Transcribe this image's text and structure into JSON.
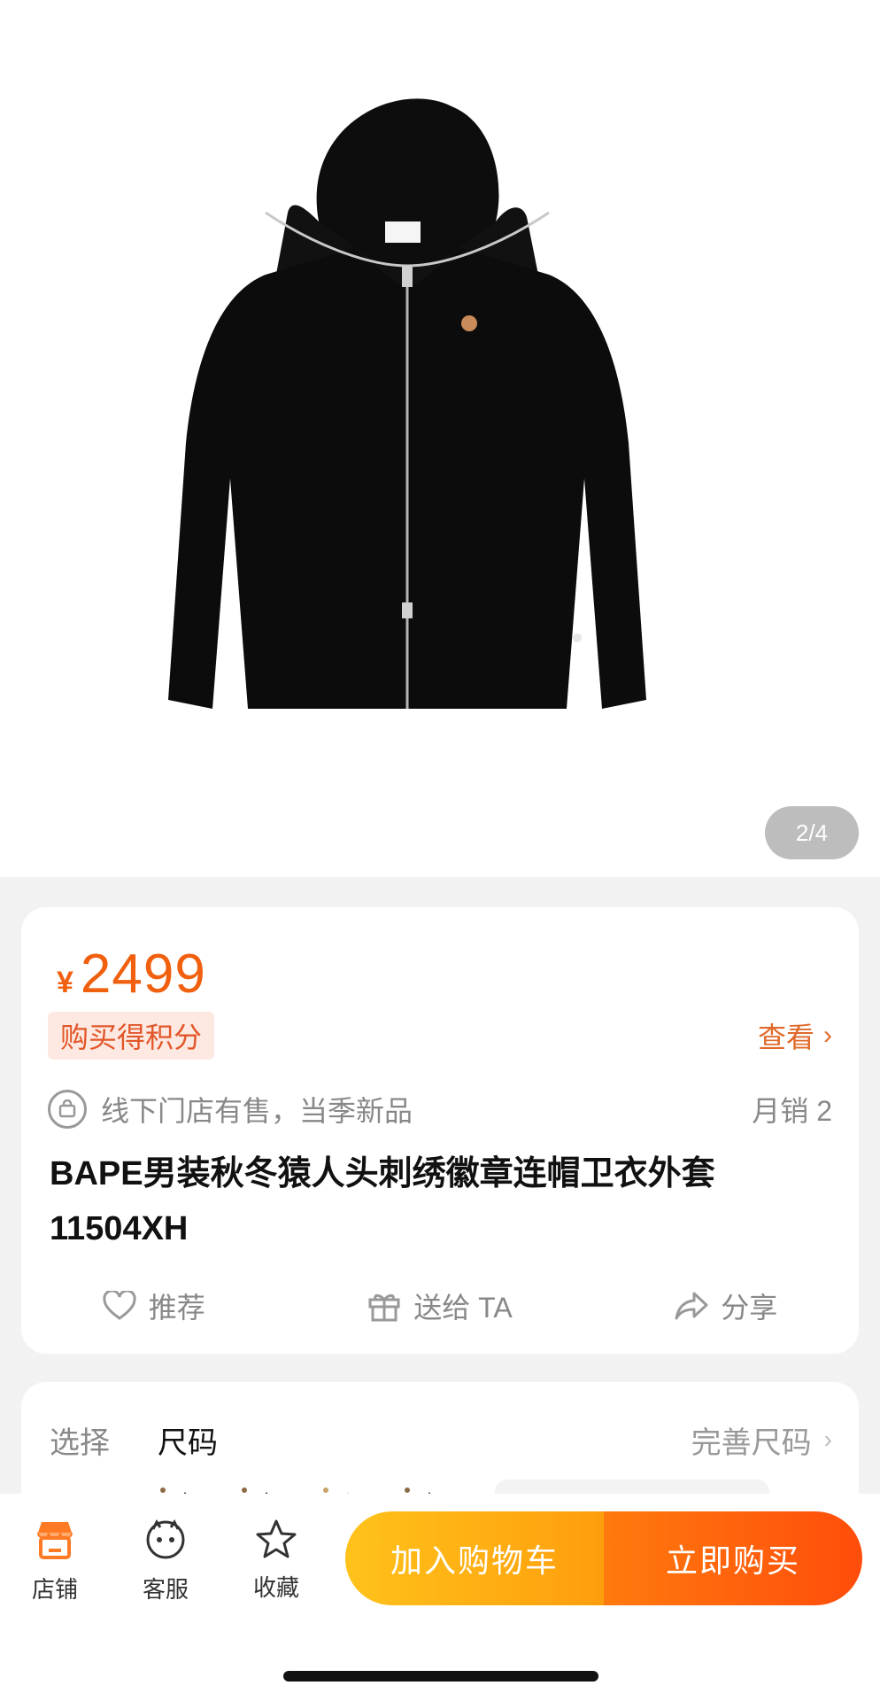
{
  "gallery": {
    "pager": "2/4"
  },
  "product": {
    "currency": "¥",
    "price": "2499",
    "points_badge": "购买得积分",
    "view_link": "查看",
    "store_note": "线下门店有售，当季新品",
    "monthly_sales": "月销 2",
    "title": "BAPE男装秋冬猿人头刺绣徽章连帽卫衣外套11504XH"
  },
  "actions": {
    "recommend": "推荐",
    "gift": "送给 TA",
    "share": "分享"
  },
  "selection": {
    "label": "选择",
    "value": "尺码",
    "complete_size": "完善尺码"
  },
  "bottom_bar": {
    "store": "店铺",
    "service": "客服",
    "favorite": "收藏",
    "add_to_cart": "加入购物车",
    "buy_now": "立即购买"
  },
  "colors": {
    "accent_orange": "#f0600f",
    "cart_gradient_start": "#ffc21a",
    "buy_gradient_end": "#ff4d0b"
  }
}
